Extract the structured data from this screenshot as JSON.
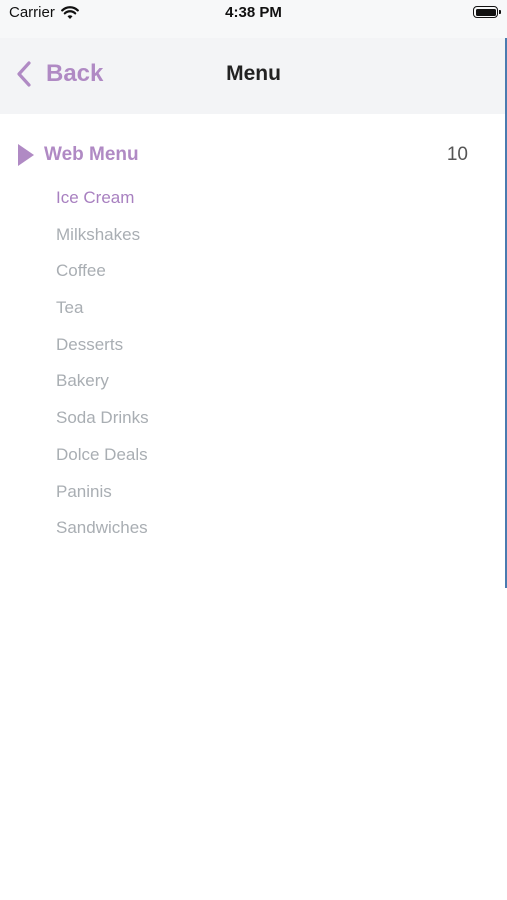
{
  "status_bar": {
    "carrier": "Carrier",
    "time": "4:38 PM"
  },
  "nav": {
    "back_label": "Back",
    "title": "Menu"
  },
  "section": {
    "title": "Web Menu",
    "count": "10"
  },
  "menu_items": [
    {
      "label": "Ice Cream",
      "active": true
    },
    {
      "label": "Milkshakes",
      "active": false
    },
    {
      "label": "Coffee",
      "active": false
    },
    {
      "label": "Tea",
      "active": false
    },
    {
      "label": "Desserts",
      "active": false
    },
    {
      "label": "Bakery",
      "active": false
    },
    {
      "label": "Soda Drinks",
      "active": false
    },
    {
      "label": "Dolce Deals",
      "active": false
    },
    {
      "label": "Paninis",
      "active": false
    },
    {
      "label": "Sandwiches",
      "active": false
    }
  ],
  "colors": {
    "accent": "#b08ac4",
    "item_active": "#a880c0",
    "item_inactive": "#a9aeb3",
    "nav_background": "#f3f4f6"
  }
}
